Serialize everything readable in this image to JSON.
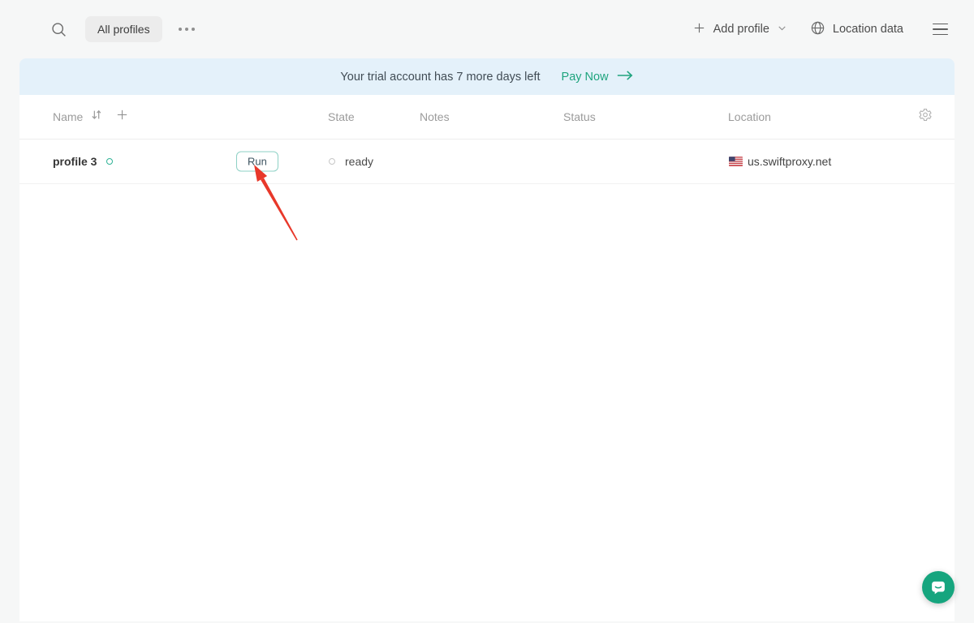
{
  "topbar": {
    "tab_all_profiles": "All profiles",
    "add_profile_label": "Add profile",
    "location_data_label": "Location data"
  },
  "banner": {
    "message": "Your trial account has 7 more days left",
    "cta_label": "Pay Now"
  },
  "table": {
    "headers": {
      "name": "Name",
      "state": "State",
      "notes": "Notes",
      "status": "Status",
      "location": "Location"
    },
    "rows": [
      {
        "name": "profile 3",
        "run_label": "Run",
        "state": "ready",
        "location": "us.swiftproxy.net",
        "location_flag": "us-flag"
      }
    ]
  },
  "icons": {
    "search": "magnifier",
    "more": "ellipsis",
    "add_profile": "plus",
    "add_profile_chevron": "chevron-down",
    "location_data": "globe",
    "menu": "hamburger",
    "name_sort": "sort-arrows-down-up",
    "add_column": "plus",
    "column_settings": "gear",
    "cta_arrow": "arrow-right",
    "annotation": "red-arrow-pointing-at-run-button",
    "chat": "chat-bubble-smile"
  },
  "colors": {
    "accent_teal": "#1ea47e",
    "banner_bg": "#e4f1fa",
    "page_bg": "#f6f7f7",
    "annotation_red": "#e8382a",
    "run_border": "#8ed1c5"
  }
}
